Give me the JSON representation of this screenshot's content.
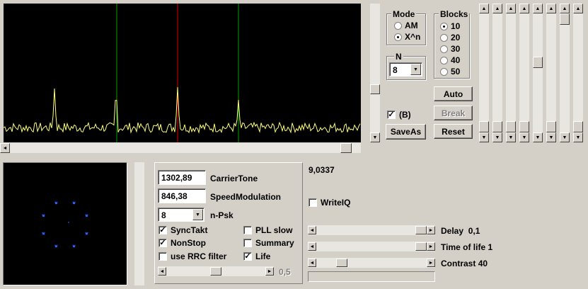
{
  "spectrum": {
    "markers": [
      {
        "color": "#00a000",
        "offset_bins": -1
      },
      {
        "color": "#e00000",
        "offset_bins": 0
      },
      {
        "color": "#00a000",
        "offset_bins": 1
      }
    ],
    "trace_color": "#ffff80"
  },
  "mode": {
    "title": "Mode",
    "options": [
      "AM",
      "X^n"
    ],
    "selected": "X^n"
  },
  "blocks": {
    "title": "Blocks",
    "options": [
      "10",
      "20",
      "30",
      "40",
      "50"
    ],
    "selected": "10"
  },
  "n": {
    "title": "N",
    "value": "8"
  },
  "b_check": {
    "label": "(B)",
    "checked": true
  },
  "buttons": {
    "auto": "Auto",
    "break": "Break",
    "saveas": "SaveAs",
    "reset": "Reset"
  },
  "right_sliders": {
    "count": 8,
    "levels": [
      1.0,
      1.0,
      1.0,
      1.0,
      0.4,
      1.0,
      0.0,
      1.0
    ]
  },
  "params": {
    "carrier_tone": {
      "value": "1302,89",
      "label": "CarrierTone"
    },
    "speed_modulation": {
      "value": "846,38",
      "label": "SpeedModulation"
    },
    "npsk": {
      "value": "8",
      "label": "n-Psk"
    }
  },
  "checks": {
    "synctakt": {
      "label": "SyncTakt",
      "checked": true
    },
    "pll_slow": {
      "label": "PLL slow",
      "checked": false
    },
    "nonstop": {
      "label": "NonStop",
      "checked": true
    },
    "summary": {
      "label": "Summary",
      "checked": false
    },
    "rrc": {
      "label": "use RRC filter",
      "checked": false
    },
    "life": {
      "label": "Life",
      "checked": true
    },
    "writeiq": {
      "label": "WriteIQ",
      "checked": false
    }
  },
  "rrc_slider": {
    "value_label": "0,5",
    "level": 0.5
  },
  "readout": "9,0337",
  "delay": {
    "label": "Delay",
    "value": "0,1",
    "level": 1.0
  },
  "time_of_life": {
    "label": "Time of life",
    "value": "1",
    "level": 1.0
  },
  "contrast": {
    "label": "Contrast",
    "value": "40",
    "level": 0.2
  }
}
